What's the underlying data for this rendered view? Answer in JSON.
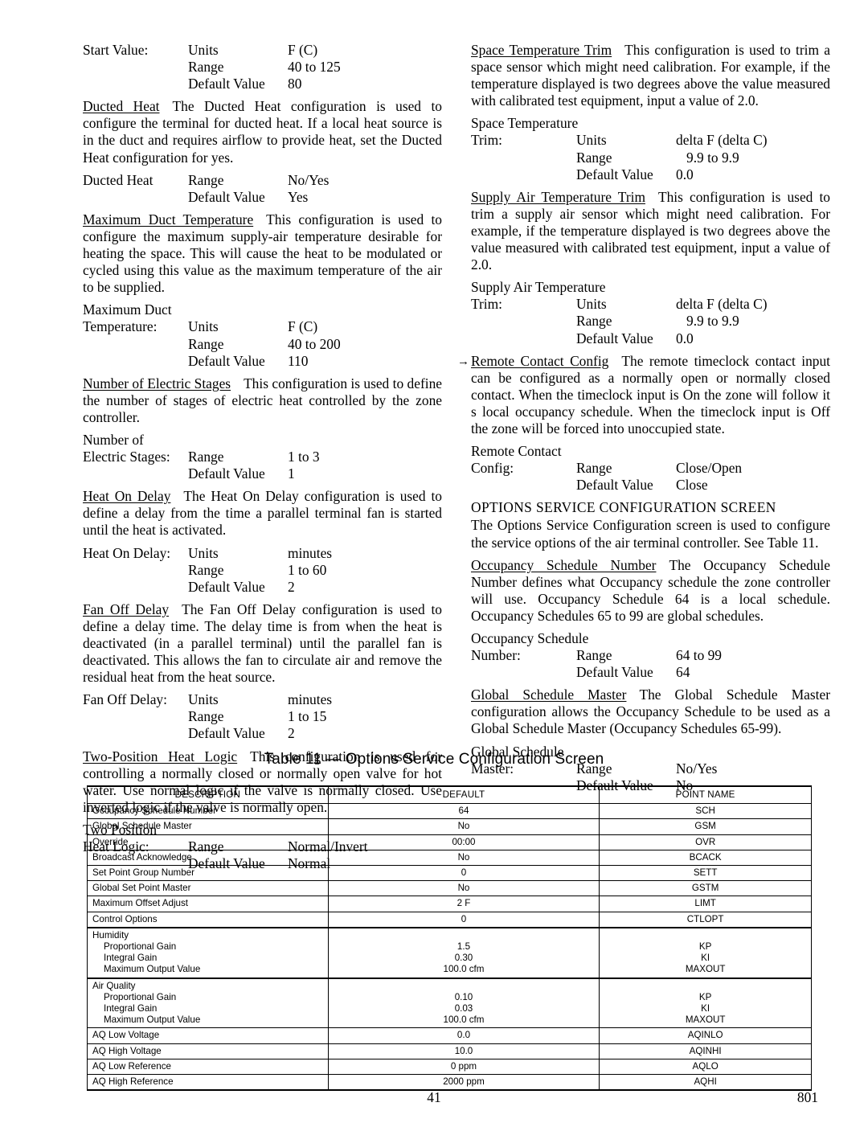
{
  "left_column": {
    "blocks": [
      {
        "kind": "spec",
        "title": null,
        "label": "Start Value:",
        "rows": [
          {
            "key": "Units",
            "value": "F (C)"
          },
          {
            "key": "Range",
            "value": "40 to 125"
          },
          {
            "key": "Default Value",
            "value": "80"
          }
        ]
      },
      {
        "kind": "para",
        "term": "Ducted Heat",
        "text": "The Ducted Heat configuration is used to configure the terminal for ducted heat. If a local heat source is in the duct and requires airflow to provide heat, set the Ducted Heat configuration for yes."
      },
      {
        "kind": "spec",
        "title": null,
        "label": "Ducted Heat",
        "rows": [
          {
            "key": "Range",
            "value": "No/Yes"
          },
          {
            "key": "Default Value",
            "value": "Yes"
          }
        ]
      },
      {
        "kind": "para",
        "term": "Maximum Duct Temperature",
        "text": "This configuration is used to configure the maximum supply-air temperature desirable for heating the space. This will cause the heat to be modulated or cycled using this value as the maximum temperature of the air to be supplied."
      },
      {
        "kind": "spec",
        "title": "Maximum Duct",
        "label": "Temperature:",
        "rows": [
          {
            "key": "Units",
            "value": "F (C)"
          },
          {
            "key": "Range",
            "value": "40 to 200"
          },
          {
            "key": "Default Value",
            "value": "110"
          }
        ]
      },
      {
        "kind": "para",
        "term": "Number of Electric Stages",
        "text": "This configuration is used to define the number of stages of electric heat controlled by the zone controller."
      },
      {
        "kind": "spec",
        "title": "Number of",
        "label": "Electric Stages:",
        "rows": [
          {
            "key": "Range",
            "value": "1 to 3"
          },
          {
            "key": "Default Value",
            "value": "1"
          }
        ]
      },
      {
        "kind": "para",
        "term": "Heat On Delay",
        "text": "The Heat On Delay configuration is used to define a delay from the time a parallel terminal fan is started until the heat is activated."
      },
      {
        "kind": "spec",
        "title": null,
        "label": "Heat On Delay:",
        "rows": [
          {
            "key": "Units",
            "value": "minutes"
          },
          {
            "key": "Range",
            "value": "1 to 60"
          },
          {
            "key": "Default Value",
            "value": "2"
          }
        ]
      },
      {
        "kind": "para",
        "term": "Fan Off Delay",
        "text": "The Fan Off Delay configuration is used to define a delay time. The delay time is from when the heat is deactivated (in a parallel terminal) until the parallel fan is deactivated. This allows the fan to circulate air and remove the residual heat from the heat source."
      },
      {
        "kind": "spec",
        "title": null,
        "label": "Fan Off Delay:",
        "rows": [
          {
            "key": "Units",
            "value": "minutes"
          },
          {
            "key": "Range",
            "value": "1 to 15"
          },
          {
            "key": "Default Value",
            "value": "2"
          }
        ]
      },
      {
        "kind": "para",
        "term": "Two-Position Heat Logic",
        "text": "This configuration is used for controlling a normally closed or normally open valve for hot water. Use normal logic if the valve is normally closed. Use inverted logic if the valve is normally open."
      },
      {
        "kind": "spec",
        "title": "Two Position",
        "label": "Heat Logic:",
        "rows": [
          {
            "key": "Range",
            "value": "Normal/Invert"
          },
          {
            "key": "Default Value",
            "value": "Normal"
          }
        ]
      }
    ]
  },
  "right_column": {
    "blocks": [
      {
        "kind": "para",
        "term": "Space Temperature Trim",
        "text": "This configuration is used to trim a space sensor which might need calibration. For example, if the temperature displayed is two degrees above the value measured with calibrated test equipment, input a value of  2.0."
      },
      {
        "kind": "spec",
        "title": "Space Temperature",
        "label": "Trim:",
        "rows": [
          {
            "key": "Units",
            "value": "delta F (delta C)"
          },
          {
            "key": "Range",
            "value": "9.9 to 9.9",
            "indent": true
          },
          {
            "key": "Default Value",
            "value": "0.0"
          }
        ]
      },
      {
        "kind": "para",
        "term": "Supply Air Temperature Trim",
        "text": "This configuration is used to trim a supply air sensor which might need calibration. For example, if the temperature displayed is two degrees above the value measured with calibrated test equipment, input a value of  2.0."
      },
      {
        "kind": "spec",
        "title": "Supply Air Temperature",
        "label": "Trim:",
        "rows": [
          {
            "key": "Units",
            "value": "delta F (delta C)"
          },
          {
            "key": "Range",
            "value": "9.9 to 9.9",
            "indent": true
          },
          {
            "key": "Default Value",
            "value": "0.0"
          }
        ]
      },
      {
        "kind": "para",
        "marker": "→",
        "term": "Remote Contact Config",
        "text": "The remote timeclock contact input can be configured as a normally open or normally closed contact. When the timeclock input is  On  the zone will follow it s local occupancy schedule. When the timeclock input is  Off  the zone will be forced into unoccupied state."
      },
      {
        "kind": "spec",
        "title": "Remote Contact",
        "label": "Config:",
        "rows": [
          {
            "key": "Range",
            "value": "Close/Open"
          },
          {
            "key": "Default Value",
            "value": "Close"
          }
        ]
      },
      {
        "kind": "headline",
        "text": "OPTIONS  SERVICE  CONFIGURATION  SCREEN"
      },
      {
        "kind": "para",
        "term": null,
        "text": "The Options Service Configuration screen is used to configure the service options of the air terminal controller. See Table 11."
      },
      {
        "kind": "para",
        "term": "Occupancy Schedule Number",
        "text": "The Occupancy Schedule Number defines what Occupancy schedule the zone controller will use. Occupancy Schedule 64 is a local schedule. Occupancy Schedules 65 to 99 are global schedules."
      },
      {
        "kind": "spec",
        "title": "Occupancy Schedule",
        "label": "Number:",
        "rows": [
          {
            "key": "Range",
            "value": "64 to 99"
          },
          {
            "key": "Default Value",
            "value": "64"
          }
        ]
      },
      {
        "kind": "para",
        "term": "Global Schedule Master",
        "text": "The Global Schedule Master configuration allows the Occupancy Schedule to be used as a Global Schedule Master (Occupancy Schedules 65-99)."
      },
      {
        "kind": "spec",
        "title": "Global Schedule",
        "label": "Master:",
        "rows": [
          {
            "key": "Range",
            "value": "No/Yes"
          },
          {
            "key": "Default Value",
            "value": "No"
          }
        ]
      }
    ]
  },
  "table": {
    "title": "Table 11 — Options Service Configuration Screen",
    "headers": [
      "DESCRIPTION",
      "DEFAULT",
      "POINT NAME"
    ],
    "rows": [
      {
        "description": "Occupancy Schedule Number",
        "default": "64",
        "point_name": "SCH"
      },
      {
        "description": "Global Schedule Master",
        "default": "No",
        "point_name": "GSM"
      },
      {
        "description": "Override",
        "default": "00:00",
        "point_name": "OVR"
      },
      {
        "description": "Broadcast Acknowledge",
        "default": "No",
        "point_name": "BCACK"
      },
      {
        "description": "Set Point Group Number",
        "default": "0",
        "point_name": "SETT"
      },
      {
        "description": "Global Set Point Master",
        "default": "No",
        "point_name": "GSTM"
      },
      {
        "description": "Maximum Offset Adjust",
        "default": "2 F",
        "point_name": "LIMT"
      },
      {
        "description": "Control Options",
        "default": "0",
        "point_name": "CTLOPT"
      },
      {
        "group": "Humidity",
        "sub_rows": [
          {
            "description": "Proportional Gain",
            "default": "1.5",
            "point_name": "KP"
          },
          {
            "description": "Integral Gain",
            "default": "0.30",
            "point_name": "KI"
          },
          {
            "description": "Maximum Output Value",
            "default": "100.0 cfm",
            "point_name": "MAXOUT"
          }
        ]
      },
      {
        "group": "Air Quality",
        "sub_rows": [
          {
            "description": "Proportional Gain",
            "default": "0.10",
            "point_name": "KP"
          },
          {
            "description": "Integral Gain",
            "default": "0.03",
            "point_name": "KI"
          },
          {
            "description": "Maximum Output Value",
            "default": "100.0 cfm",
            "point_name": "MAXOUT"
          }
        ]
      },
      {
        "description": "AQ Low Voltage",
        "default": "0.0",
        "point_name": "AQINLO"
      },
      {
        "description": "AQ High Voltage",
        "default": "10.0",
        "point_name": "AQINHI"
      },
      {
        "description": "AQ Low Reference",
        "default": "0 ppm",
        "point_name": "AQLO"
      },
      {
        "description": "AQ High Reference",
        "default": "2000 ppm",
        "point_name": "AQHI"
      }
    ]
  },
  "footer": {
    "page_number": "41",
    "document_number": "801"
  }
}
